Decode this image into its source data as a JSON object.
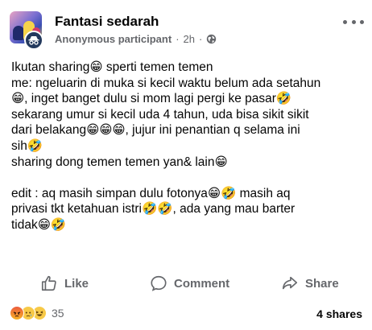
{
  "post": {
    "group_name": "Fantasi sedarah",
    "author": "Anonymous participant",
    "separator": "·",
    "time": "2h",
    "lines": [
      "Ikutan sharing😁 sperti temen temen",
      "me: ngeluarin di muka si kecil waktu belum ada setahun",
      "😁, inget banget dulu si mom lagi pergi ke pasar🤣",
      "sekarang umur si kecil uda 4 tahun, uda bisa sikit sikit",
      "dari belakang😁😁😁, jujur ini penantian q selama ini",
      "sih🤣",
      "sharing dong temen temen yan& lain😁"
    ],
    "edit_lines": [
      "edit : aq masih simpan dulu fotonya😁🤣 masih aq",
      "privasi tkt ketahuan istri🤣🤣, ada yang mau barter",
      "tidak😁🤣"
    ]
  },
  "actions": {
    "like_label": "Like",
    "comment_label": "Comment",
    "share_label": "Share"
  },
  "footer": {
    "reaction_icons": [
      "angry-reaction-icon",
      "sad-reaction-icon",
      "haha-reaction-icon"
    ],
    "reaction_count": "35",
    "shares": "4 shares"
  }
}
